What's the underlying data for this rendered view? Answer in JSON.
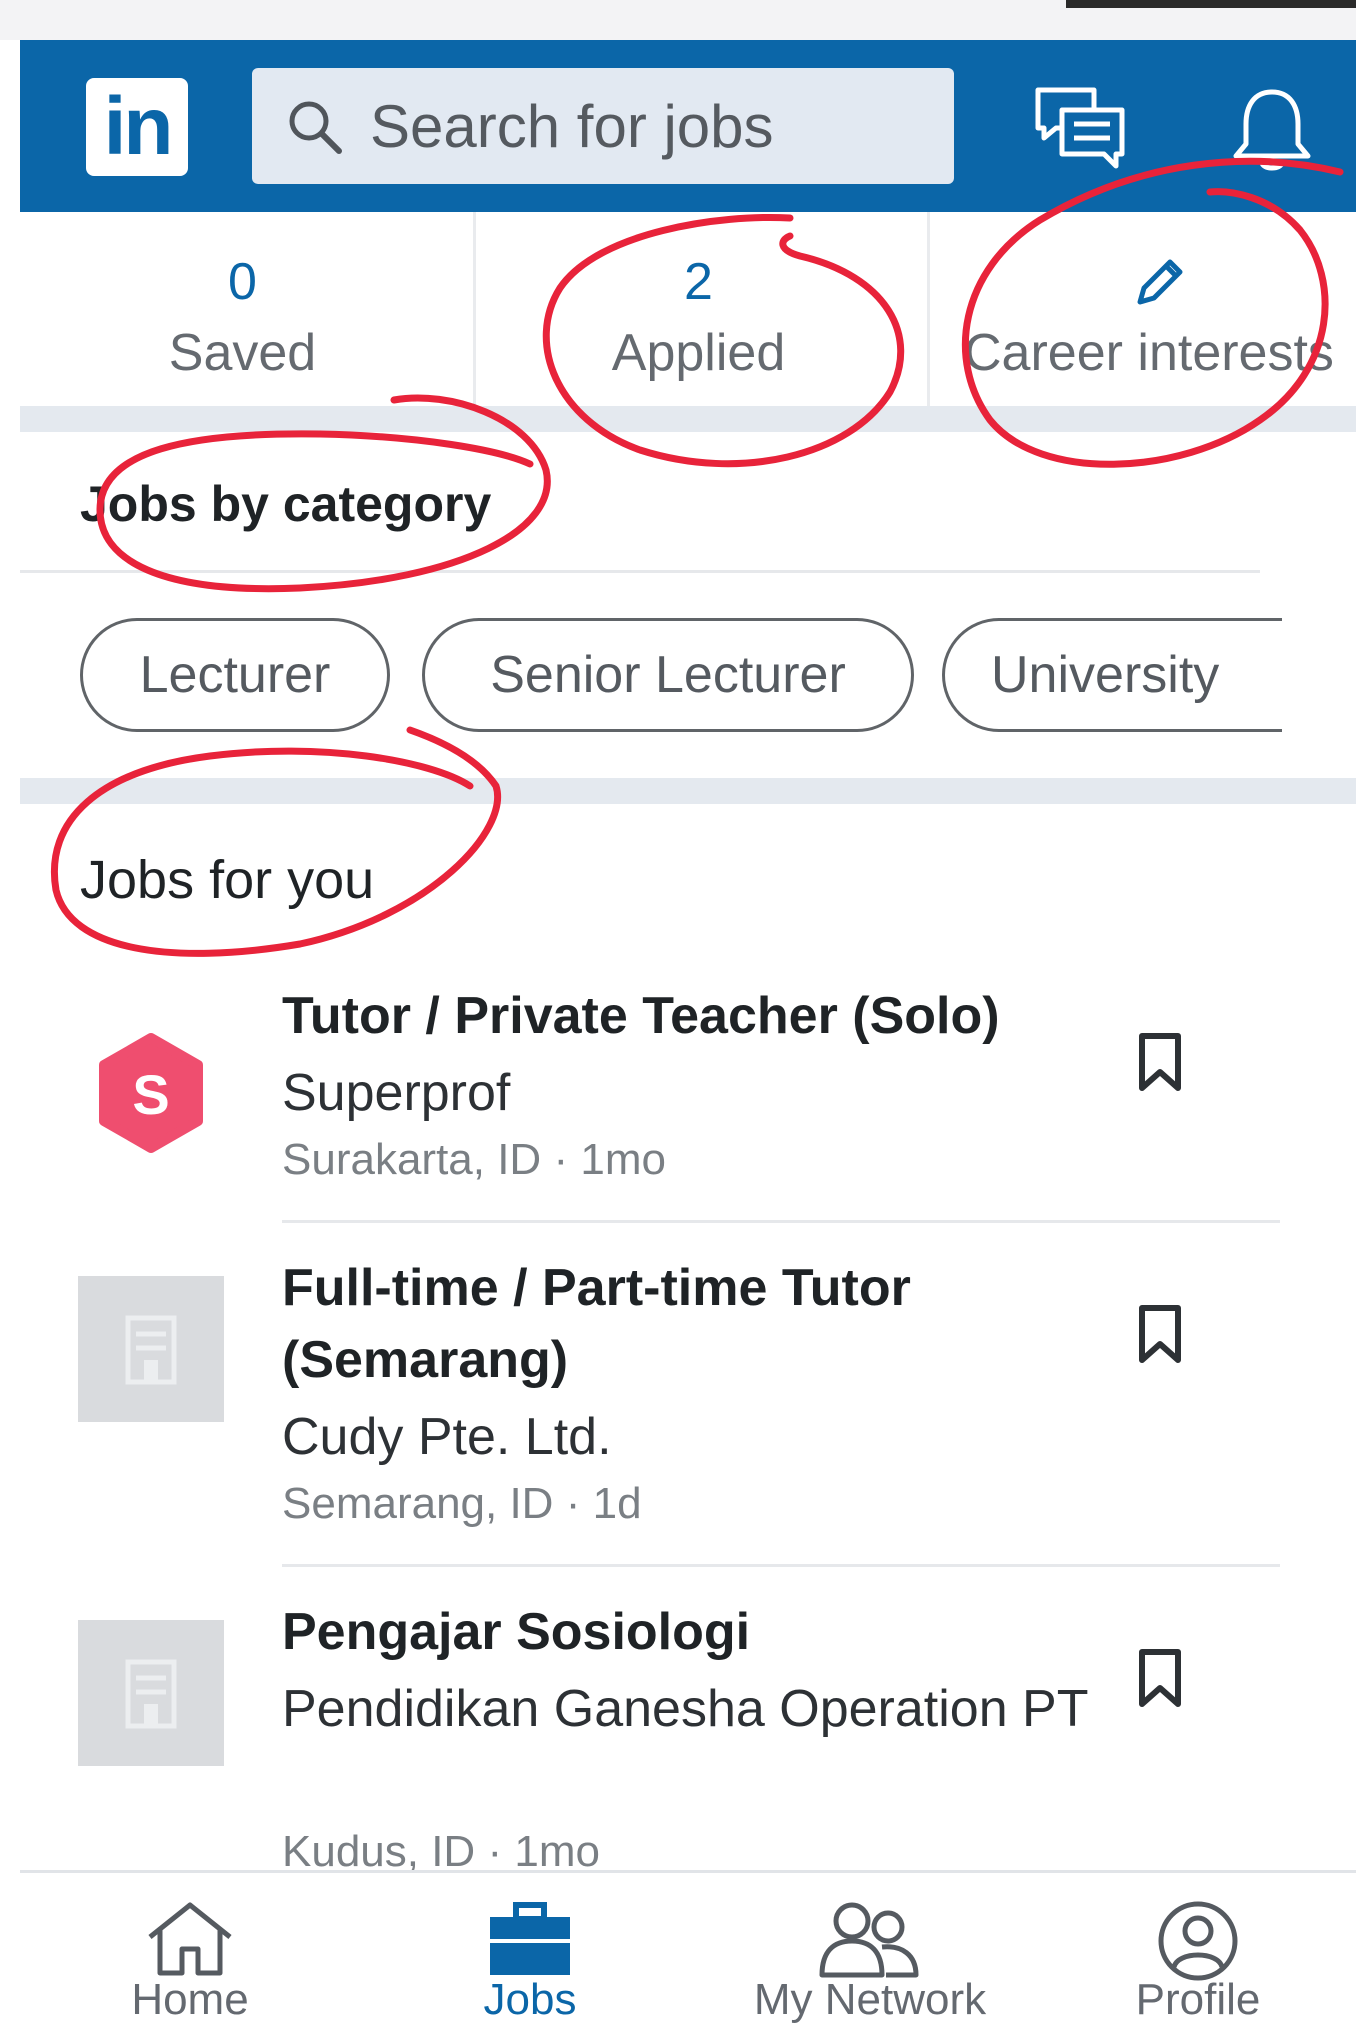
{
  "header": {
    "logo_text": "in",
    "search_placeholder": "Search for jobs",
    "brand_color": "#0b66a8"
  },
  "stats": [
    {
      "count": "0",
      "label": "Saved"
    },
    {
      "count": "2",
      "label": "Applied"
    },
    {
      "count": "",
      "label": "Career interests"
    }
  ],
  "categories": {
    "title": "Jobs by category",
    "chips": [
      "Lecturer",
      "Senior Lecturer",
      "University"
    ]
  },
  "jobs_for_you": {
    "title": "Jobs for you",
    "items": [
      {
        "title": "Tutor / Private Teacher (Solo)",
        "company": "Superprof",
        "location": "Surakarta, ID",
        "age": "1mo",
        "logo_letter": "S"
      },
      {
        "title": "Full-time / Part-time Tutor (Semarang)",
        "company": "Cudy Pte. Ltd.",
        "location": "Semarang, ID",
        "age": "1d"
      },
      {
        "title": "Pengajar Sosiologi",
        "company": "Pendidikan Ganesha Operation PT",
        "location": "Kudus, ID",
        "age": "1mo"
      }
    ]
  },
  "bottom_nav": [
    {
      "label": "Home",
      "icon": "home-icon"
    },
    {
      "label": "Jobs",
      "icon": "briefcase-icon"
    },
    {
      "label": "My Network",
      "icon": "people-icon"
    },
    {
      "label": "Profile",
      "icon": "profile-icon"
    }
  ],
  "meta_separator": "·",
  "annotation_color": "#e8233a"
}
